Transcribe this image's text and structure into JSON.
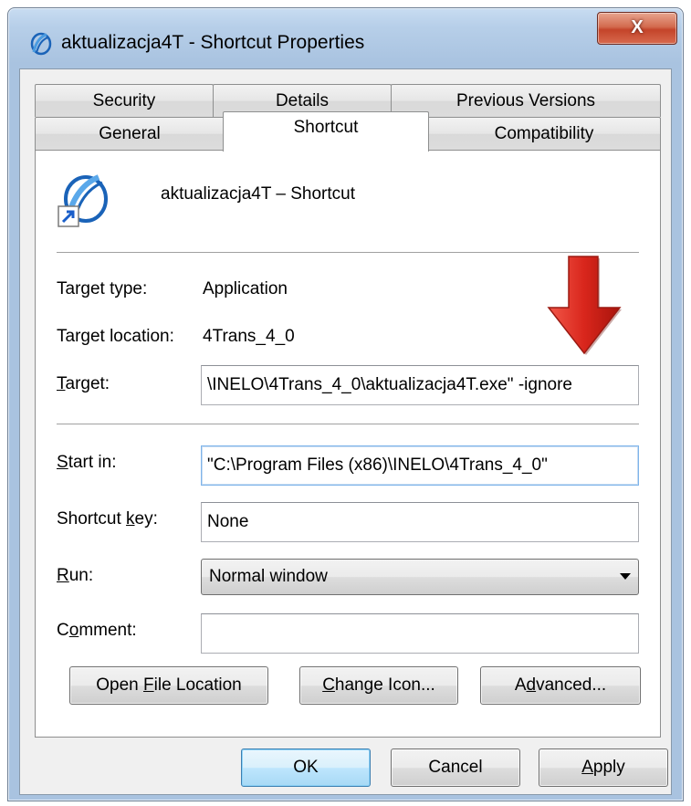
{
  "window": {
    "title": "aktualizacja4T - Shortcut Properties",
    "close_label": "X"
  },
  "tabs": {
    "row1": [
      {
        "label": "Security"
      },
      {
        "label": "Details"
      },
      {
        "label": "Previous Versions"
      }
    ],
    "row2": [
      {
        "label": "General"
      },
      {
        "label": "Shortcut",
        "active": true
      },
      {
        "label": "Compatibility"
      }
    ]
  },
  "shortcut": {
    "name": "aktualizacja4T – Shortcut",
    "target_type_label": "Target type:",
    "target_type_value": "Application",
    "target_location_label": "Target location:",
    "target_location_value": "4Trans_4_0",
    "target_label_underlined": "T",
    "target_label_rest": "arget:",
    "target_value": "\\INELO\\4Trans_4_0\\aktualizacja4T.exe\" -ignore",
    "start_in_label_underlined": "S",
    "start_in_label_rest": "tart in:",
    "start_in_value": "\"C:\\Program Files (x86)\\INELO\\4Trans_4_0\"",
    "shortcut_key_label_pre": "Shortcut ",
    "shortcut_key_label_underlined": "k",
    "shortcut_key_label_rest": "ey:",
    "shortcut_key_value": "None",
    "run_label_underlined": "R",
    "run_label_rest": "un:",
    "run_value": "Normal window",
    "comment_label_pre": "C",
    "comment_label_underlined": "o",
    "comment_label_rest": "mment:",
    "comment_value": ""
  },
  "buttons": {
    "open_file_location_pre": "Open ",
    "open_file_location_underlined": "F",
    "open_file_location_rest": "ile Location",
    "change_icon_underlined": "C",
    "change_icon_rest": "hange Icon...",
    "advanced_pre": "A",
    "advanced_underlined": "d",
    "advanced_rest": "vanced...",
    "ok": "OK",
    "cancel": "Cancel",
    "apply_underlined": "A",
    "apply_rest": "pply"
  },
  "colors": {
    "annotation_arrow": "#d9261c",
    "close_button": "#c4442a"
  },
  "icons": {
    "app_icon": "4trans-app-icon",
    "shortcut_icon": "4trans-shortcut-icon",
    "annotation": "red-down-arrow-icon"
  }
}
